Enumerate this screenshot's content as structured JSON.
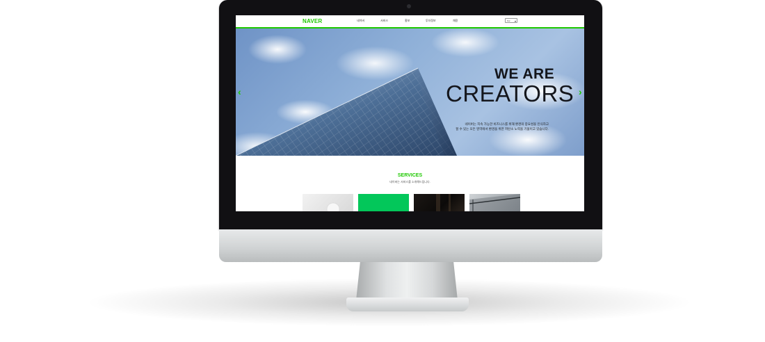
{
  "header": {
    "logo": "NAVER",
    "nav": [
      "네이버",
      "서비스",
      "홍보",
      "투자정보",
      "채용"
    ],
    "language": "Kor"
  },
  "hero": {
    "title_line1": "WE ARE",
    "title_line2": "CREATORS",
    "description_line1": "네이버는 지속 가능한 비즈니스를 위해 환경의 중요성을 인식하고",
    "description_line2": "할 수 있는 모든 영역에서 환경을 위한 저탄소 노력을 기울이고 있습니다.",
    "prev_icon": "chevron-left-icon",
    "next_icon": "chevron-right-icon"
  },
  "services": {
    "title": "SERVICES",
    "subtitle": "네이버는 서비스를 소개해드립니다."
  },
  "colors": {
    "brand": "#1ec800",
    "bezel": "#111013",
    "card_green": "#03c75a"
  }
}
